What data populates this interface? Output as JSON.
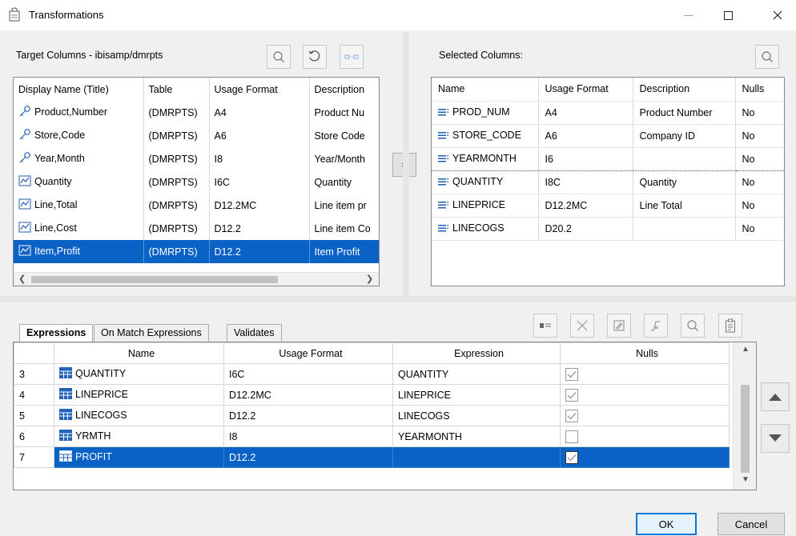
{
  "window": {
    "title": "Transformations",
    "minimize_icon": "minimize-icon",
    "maximize_icon": "maximize-icon",
    "close_icon": "close-icon"
  },
  "target": {
    "title": "Target Columns - ibisamp/dmrpts",
    "columns": [
      "Display Name (Title)",
      "Table",
      "Usage Format",
      "Description"
    ],
    "rows": [
      {
        "icon": "key-icon",
        "name": "Product,Number",
        "table": "(DMRPTS)",
        "format": "A4",
        "desc": "Product Nu"
      },
      {
        "icon": "key-icon",
        "name": "Store,Code",
        "table": "(DMRPTS)",
        "format": "A6",
        "desc": "Store Code"
      },
      {
        "icon": "key-icon",
        "name": "Year,Month",
        "table": "(DMRPTS)",
        "format": "I8",
        "desc": "Year/Month"
      },
      {
        "icon": "measure-icon",
        "name": "Quantity",
        "table": "(DMRPTS)",
        "format": "I6C",
        "desc": "Quantity"
      },
      {
        "icon": "measure-icon",
        "name": "Line,Total",
        "table": "(DMRPTS)",
        "format": "D12.2MC",
        "desc": "Line item pr"
      },
      {
        "icon": "measure-icon",
        "name": "Line,Cost",
        "table": "(DMRPTS)",
        "format": "D12.2",
        "desc": "Line item Co"
      },
      {
        "icon": "measure-icon",
        "name": "Item,Profit",
        "table": "(DMRPTS)",
        "format": "D12.2",
        "desc": "Item Profit",
        "selected": true
      }
    ]
  },
  "map_button": {
    "label": "="
  },
  "selected": {
    "title": "Selected Columns:",
    "columns": [
      "Name",
      "Usage Format",
      "Description",
      "Nulls"
    ],
    "rows": [
      {
        "name": "PROD_NUM",
        "format": "A4",
        "desc": "Product Number",
        "nulls": "No"
      },
      {
        "name": "STORE_CODE",
        "format": "A6",
        "desc": "Company ID",
        "nulls": "No"
      },
      {
        "name": "YEARMONTH",
        "format": "I6",
        "desc": "",
        "nulls": "No",
        "focused": true
      },
      {
        "name": "QUANTITY",
        "format": "I8C",
        "desc": "Quantity",
        "nulls": "No"
      },
      {
        "name": "LINEPRICE",
        "format": "D12.2MC",
        "desc": "Line Total",
        "nulls": "No"
      },
      {
        "name": "LINECOGS",
        "format": "D20.2",
        "desc": "",
        "nulls": "No"
      }
    ]
  },
  "tabs": [
    {
      "label": "Expressions",
      "active": true
    },
    {
      "label": "On Match Expressions",
      "active": false
    },
    {
      "label": "Validates",
      "active": false
    }
  ],
  "expressions": {
    "columns": [
      "Name",
      "Usage Format",
      "Expression",
      "Nulls"
    ],
    "rows": [
      {
        "num": "3",
        "name": "QUANTITY",
        "format": "I6C",
        "expr": "QUANTITY",
        "nulls": true
      },
      {
        "num": "4",
        "name": "LINEPRICE",
        "format": "D12.2MC",
        "expr": "LINEPRICE",
        "nulls": true
      },
      {
        "num": "5",
        "name": "LINECOGS",
        "format": "D12.2",
        "expr": "LINECOGS",
        "nulls": true
      },
      {
        "num": "6",
        "name": "YRMTH",
        "format": "I8",
        "expr": "YEARMONTH",
        "nulls": false
      },
      {
        "num": "7",
        "name": "PROFIT",
        "format": "D12.2",
        "expr": "",
        "nulls": true,
        "selected": true
      }
    ]
  },
  "buttons": {
    "ok": "OK",
    "cancel": "Cancel"
  },
  "colors": {
    "selection": "#0a62c7",
    "accent": "#0078d7",
    "icon_blue": "#1f5fb3"
  }
}
